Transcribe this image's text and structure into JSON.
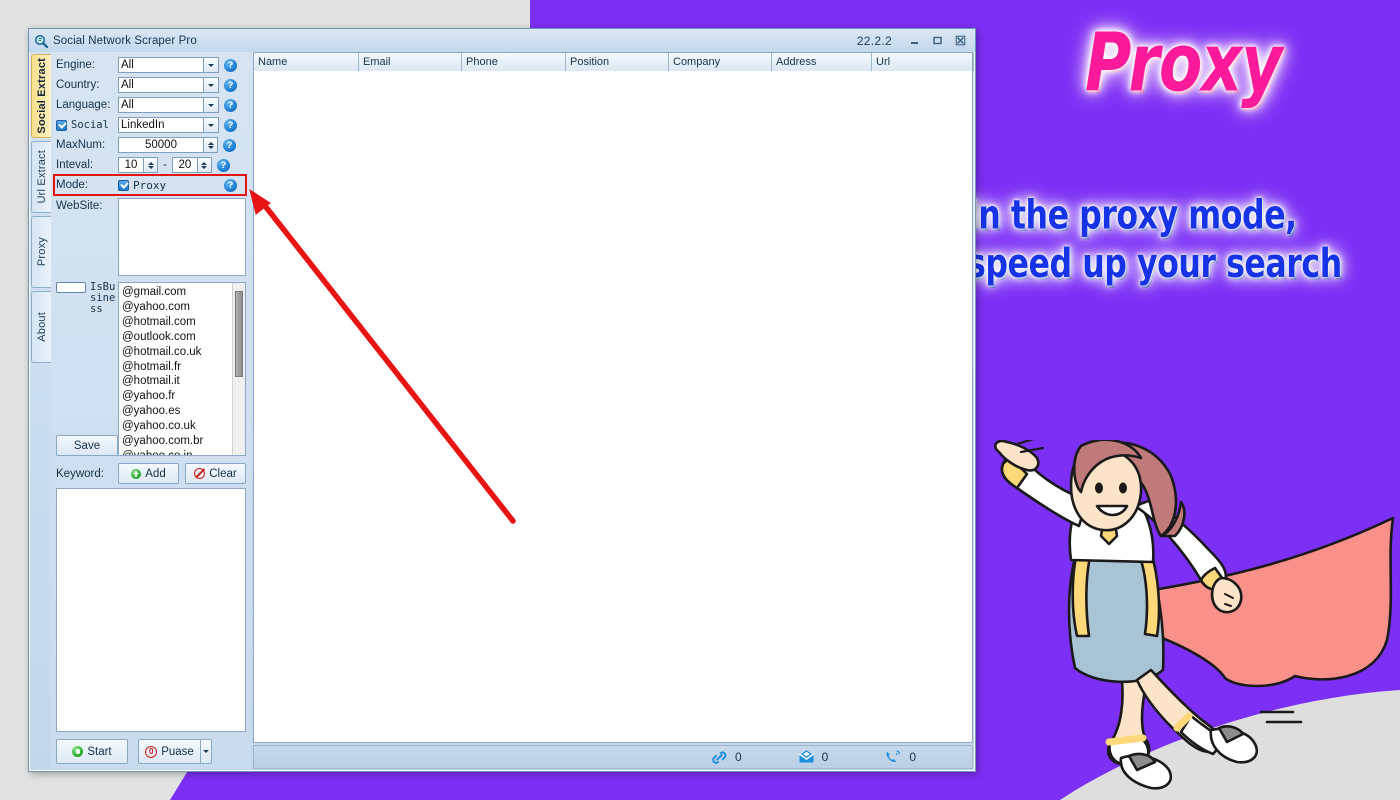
{
  "promo": {
    "title": "Proxy",
    "subtitle_line1": "In the proxy mode,",
    "subtitle_line2": "speed up your search",
    "bg_color": "#7c2ff5",
    "title_color": "#fb1a9a",
    "subtitle_color": "#1733e8",
    "page_bg_color": "#e2e2e2"
  },
  "window": {
    "title": "Social Network Scraper Pro",
    "title_icon": "magnifier-icon",
    "version": "22.2.2",
    "minimize_icon": "minimize-icon",
    "maximize_icon": "maximize-icon",
    "close_icon": "close-icon"
  },
  "side_tabs": [
    {
      "label": "Social Extract",
      "active": true
    },
    {
      "label": "Url Extract",
      "active": false
    },
    {
      "label": "Proxy",
      "active": false
    },
    {
      "label": "About",
      "active": false
    }
  ],
  "form": {
    "engine": {
      "label": "Engine:",
      "value": "All",
      "help": "?"
    },
    "country": {
      "label": "Country:",
      "value": "All",
      "help": "?"
    },
    "language": {
      "label": "Language:",
      "value": "All",
      "help": "?"
    },
    "social": {
      "label": "Social",
      "checked": true,
      "value": "LinkedIn",
      "help": "?"
    },
    "maxnum": {
      "label": "MaxNum:",
      "value": "50000",
      "help": "?"
    },
    "inteval": {
      "label": "Inteval:",
      "from": "10",
      "separator": "-",
      "to": "20",
      "help": "?"
    },
    "mode": {
      "label": "Mode:",
      "checkbox_label": "Proxy",
      "checked": true,
      "help": "?",
      "highlight_color": "#e81414"
    },
    "website": {
      "label": "WebSite:",
      "value": ""
    },
    "isbusiness": {
      "label": "IsBusiness",
      "checked": false
    },
    "save_label": "Save"
  },
  "domain_list": [
    "@gmail.com",
    "@yahoo.com",
    "@hotmail.com",
    "@outlook.com",
    "@hotmail.co.uk",
    "@hotmail.fr",
    "@hotmail.it",
    "@yahoo.fr",
    "@yahoo.es",
    "@yahoo.co.uk",
    "@yahoo.com.br",
    "@yahoo.co.in"
  ],
  "keyword": {
    "label": "Keyword:",
    "add_label": "Add",
    "add_icon": "plus-circle-icon",
    "clear_label": "Clear",
    "clear_icon": "ban-circle-icon",
    "value": ""
  },
  "actions": {
    "start_label": "Start",
    "start_icon": "play-circle-icon",
    "pause_label": "Puase",
    "pause_icon": "stop-circle-icon",
    "pause_dropdown_icon": "chevron-down-icon"
  },
  "table": {
    "columns": [
      "Name",
      "Email",
      "Phone",
      "Position",
      "Company",
      "Address",
      "Url"
    ],
    "rows": []
  },
  "status": [
    {
      "icon": "link-icon",
      "count": "0"
    },
    {
      "icon": "envelope-icon",
      "count": "0"
    },
    {
      "icon": "phone-icon",
      "count": "0"
    }
  ]
}
